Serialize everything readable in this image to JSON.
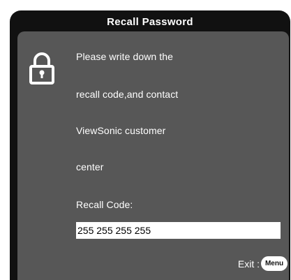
{
  "dialog": {
    "title": "Recall Password",
    "message_lines": [
      "Please write down the",
      "recall code,and contact",
      "ViewSonic customer",
      "center"
    ],
    "code_label": "Recall Code:",
    "code_value": "255 255 255 255",
    "exit_label": "Exit :",
    "menu_button_label": "Menu",
    "icon": "lock-icon"
  },
  "colors": {
    "frame": "#111111",
    "panel": "#575757",
    "text": "#ffffff",
    "field_bg": "#ffffff"
  }
}
